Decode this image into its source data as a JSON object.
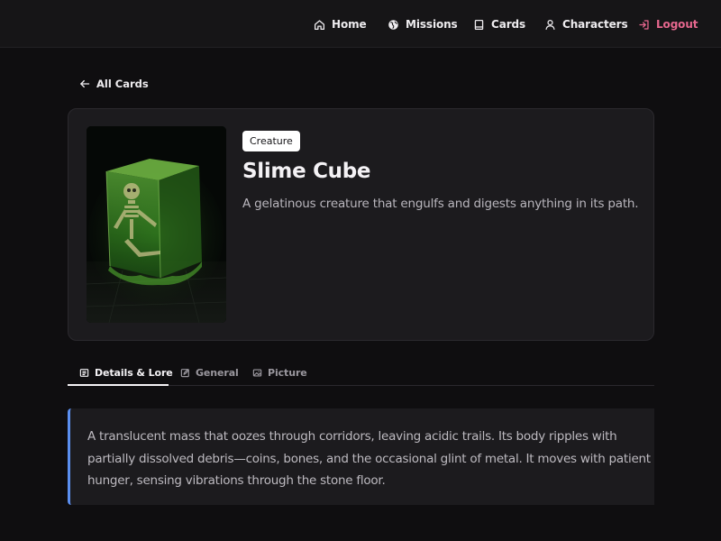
{
  "nav": {
    "items": [
      {
        "label": "Home",
        "icon": "home-icon"
      },
      {
        "label": "Missions",
        "icon": "globe-icon"
      },
      {
        "label": "Cards",
        "icon": "book-icon"
      },
      {
        "label": "Characters",
        "icon": "user-icon"
      },
      {
        "label": "Logout",
        "icon": "logout-icon"
      }
    ]
  },
  "back_link": {
    "label": "All Cards",
    "icon": "arrow-left-icon"
  },
  "card": {
    "type": "Creature",
    "title": "Slime Cube",
    "subtitle": "A gelatinous creature that engulfs and digests anything in its path."
  },
  "tabs": [
    {
      "label": "Details & Lore",
      "icon": "document-icon",
      "active": true
    },
    {
      "label": "General",
      "icon": "edit-icon",
      "active": false
    },
    {
      "label": "Picture",
      "icon": "image-icon",
      "active": false
    }
  ],
  "lore": {
    "text": "A translucent mass that oozes through corridors, leaving acidic trails. Its body ripples with partially dissolved debris—coins, bones, and the occasional glint of metal. It moves with patient hunger, sensing vibrations through the stone floor."
  },
  "colors": {
    "background": "#0f0e10",
    "panel": "#1c1b1e",
    "logout": "#e6678e",
    "lore_accent": "#5b8ff0"
  }
}
